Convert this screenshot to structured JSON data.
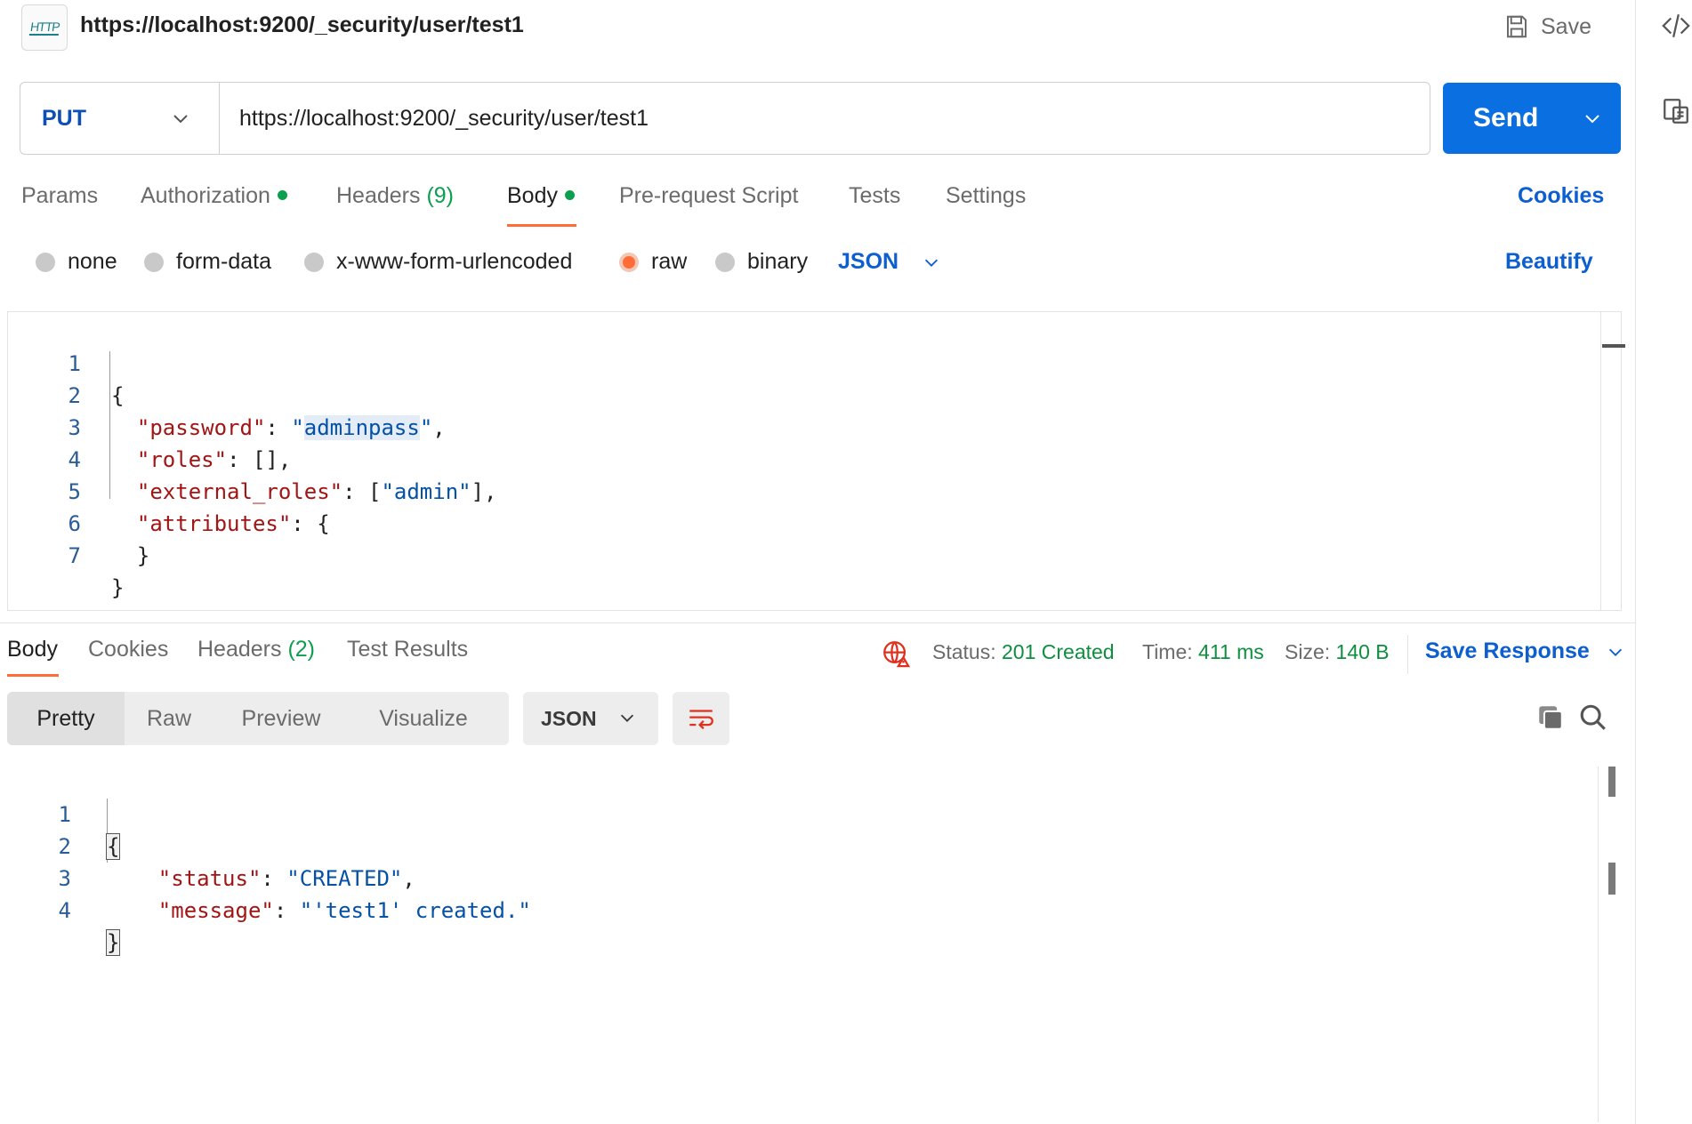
{
  "header": {
    "http_icon_label": "HTTP",
    "title": "https://localhost:9200/_security/user/test1",
    "save_label": "Save"
  },
  "request": {
    "method": "PUT",
    "url": "https://localhost:9200/_security/user/test1",
    "send_label": "Send"
  },
  "request_tabs": {
    "params": "Params",
    "authorization": "Authorization",
    "headers": "Headers",
    "headers_count": "(9)",
    "body": "Body",
    "pre_request_script": "Pre-request Script",
    "tests": "Tests",
    "settings": "Settings",
    "cookies": "Cookies"
  },
  "body_types": {
    "none": "none",
    "form_data": "form-data",
    "urlencoded": "x-www-form-urlencoded",
    "raw": "raw",
    "binary": "binary",
    "selected": "raw",
    "language": "JSON",
    "beautify": "Beautify"
  },
  "request_body": {
    "line_numbers": [
      "1",
      "2",
      "3",
      "4",
      "5",
      "6",
      "7"
    ],
    "open_brace": "{",
    "password_key": "\"password\"",
    "password_value_quote_open": "\"",
    "password_value": "adminpass",
    "password_value_quote_close": "\"",
    "roles_key": "\"roles\"",
    "roles_value": "[]",
    "external_roles_key": "\"external_roles\"",
    "external_roles_value": "\"admin\"",
    "attributes_key": "\"attributes\"",
    "attributes_open": "{",
    "attributes_close": "}",
    "close_brace": "}"
  },
  "response_tabs": {
    "body": "Body",
    "cookies": "Cookies",
    "headers": "Headers",
    "headers_count": "(2)",
    "test_results": "Test Results"
  },
  "response_meta": {
    "status_label": "Status:",
    "status_value": "201 Created",
    "time_label": "Time:",
    "time_value": "411 ms",
    "size_label": "Size:",
    "size_value": "140 B",
    "save_response": "Save Response"
  },
  "response_toolbar": {
    "pretty": "Pretty",
    "raw": "Raw",
    "preview": "Preview",
    "visualize": "Visualize",
    "format": "JSON"
  },
  "response_body": {
    "line_numbers": [
      "1",
      "2",
      "3",
      "4"
    ],
    "open_brace": "{",
    "status_key": "\"status\"",
    "status_value": "\"CREATED\"",
    "message_key": "\"message\"",
    "message_value": "\"'test1' created.\"",
    "close_brace": "}"
  },
  "colors": {
    "accent_orange": "#ff6c37",
    "send_blue": "#0a6fe0",
    "link_blue": "#0d5ecf",
    "success_green": "#0d9f4f",
    "json_key": "#a31515",
    "json_string": "#0451a5"
  },
  "icons": {
    "http": "http-request-icon",
    "save": "floppy-disk-icon",
    "code": "code-icon",
    "docs": "documentation-icon",
    "chevron": "chevron-down-icon",
    "globe": "globe-warning-icon",
    "wrap": "wrap-lines-icon",
    "copy": "copy-icon",
    "search": "search-icon"
  }
}
